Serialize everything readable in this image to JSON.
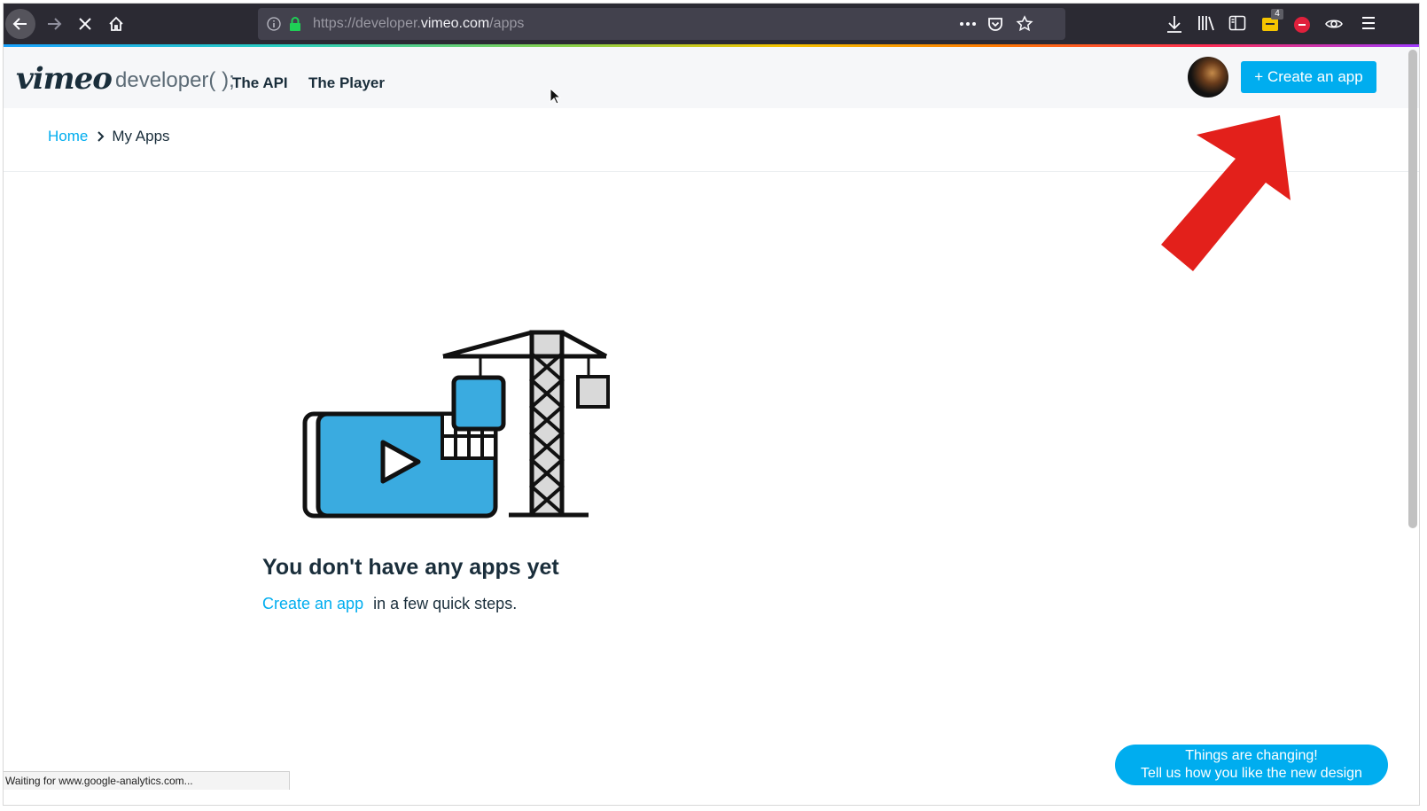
{
  "browser": {
    "url_prefix": "https://developer.",
    "url_domain": "vimeo.com",
    "url_path": "/apps",
    "extension_badge": "4",
    "status_text": "Waiting for www.google-analytics.com..."
  },
  "header": {
    "logo": "vimeo",
    "logo_suffix": "developer( );",
    "nav": [
      "The API",
      "The Player"
    ],
    "create_button": "+ Create an app"
  },
  "breadcrumb": {
    "home": "Home",
    "current": "My Apps"
  },
  "empty_state": {
    "title": "You don't have any apps yet",
    "link": "Create an app",
    "suffix": "in a few quick steps."
  },
  "feedback": {
    "line1": "Things are changing!",
    "line2": "Tell us how you like the new design"
  },
  "colors": {
    "accent": "#00adef",
    "annotation_arrow": "#e3201b"
  }
}
